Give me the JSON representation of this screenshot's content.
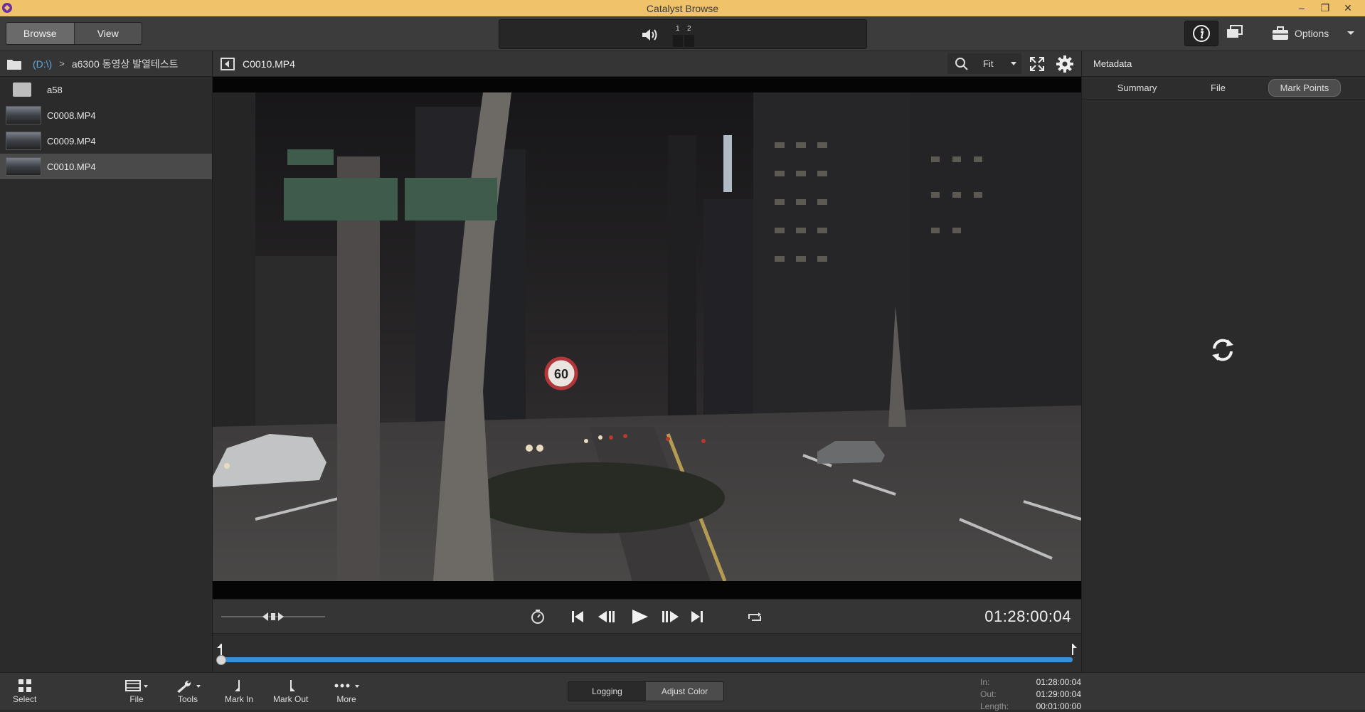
{
  "window": {
    "title": "Catalyst Browse",
    "minimize": "–",
    "restore": "❐",
    "close": "✕"
  },
  "toolbar": {
    "browse_label": "Browse",
    "view_label": "View",
    "meter_1": "1",
    "meter_2": "2",
    "options_label": "Options"
  },
  "browser": {
    "drive": "(D:\\)",
    "separator": ">",
    "folder": "a6300 동영상 발열테스트",
    "items": [
      {
        "label": "a58",
        "type": "folder"
      },
      {
        "label": "C0008.MP4",
        "type": "clip"
      },
      {
        "label": "C0009.MP4",
        "type": "clip"
      },
      {
        "label": "C0010.MP4",
        "type": "clip",
        "selected": true
      }
    ]
  },
  "viewer": {
    "clip_name": "C0010.MP4",
    "zoom": "Fit",
    "timecode": "01:28:00:04",
    "progress_fraction": 0.0
  },
  "metadata": {
    "title": "Metadata",
    "tabs": [
      "Summary",
      "File",
      "Mark Points"
    ],
    "active_tab": "Mark Points"
  },
  "bottom": {
    "select": "Select",
    "file": "File",
    "tools": "Tools",
    "mark_in": "Mark In",
    "mark_out": "Mark Out",
    "more": "More",
    "logging": "Logging",
    "adjust_color": "Adjust Color",
    "in_label": "In:",
    "in_val": "01:28:00:04",
    "out_label": "Out:",
    "out_val": "01:29:00:04",
    "length_label": "Length:",
    "length_val": "00:01:00:00"
  },
  "colors": {
    "titlebar": "#f0c36a",
    "accent_timeline": "#3b8fd4",
    "drive_link": "#5aa8e0"
  }
}
